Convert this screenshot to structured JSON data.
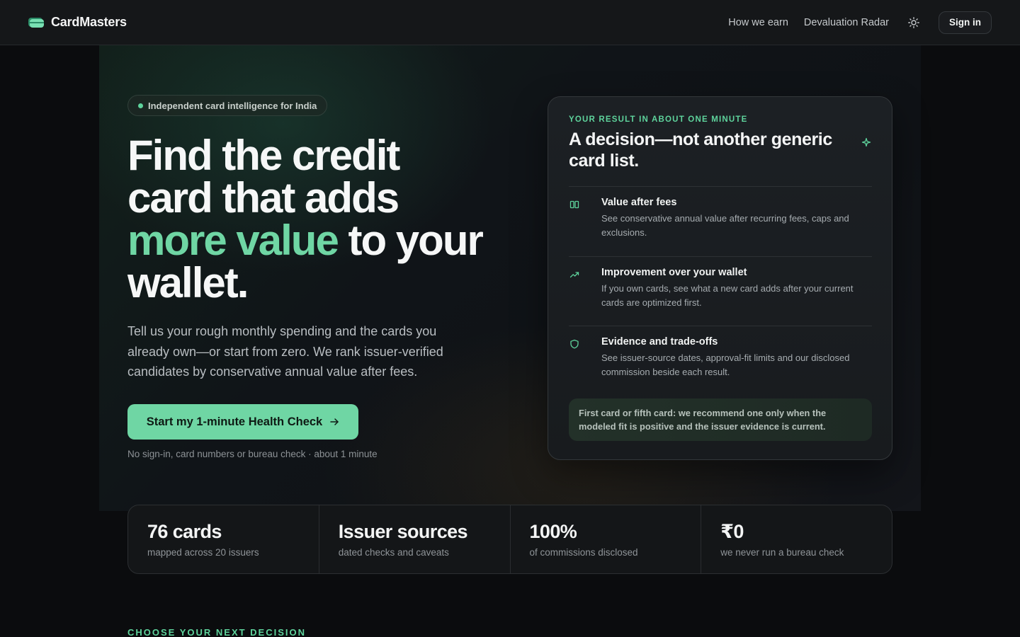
{
  "header": {
    "brand": "CardMasters",
    "nav": [
      "How we earn",
      "Devaluation Radar"
    ],
    "theme_icon": "sun-icon",
    "signin_label": "Sign in"
  },
  "hero": {
    "eyebrow": "Independent card intelligence for India",
    "title_line1": "Find the credit",
    "title_line2": "card that adds",
    "title_accent": "more value",
    "title_after_accent": " to your",
    "title_line4": "wallet.",
    "subtitle": "Tell us your rough monthly spending and the cards you already own—or start from zero. We rank issuer-verified candidates by conservative annual value after fees.",
    "cta_label": "Start my 1-minute Health Check",
    "cta_icon": "arrow-right-icon",
    "cta_note": "No sign-in, card numbers or bureau check · about 1 minute"
  },
  "result_card": {
    "eyebrow": "YOUR RESULT IN ABOUT ONE MINUTE",
    "title": "A decision—not another generic card list.",
    "sparkle_icon": "sparkle-icon",
    "items": [
      {
        "icon": "columns-icon",
        "title": "Value after fees",
        "desc": "See conservative annual value after recurring fees, caps and exclusions."
      },
      {
        "icon": "trending-up-icon",
        "title": "Improvement over your wallet",
        "desc": "If you own cards, see what a new card adds after your current cards are optimized first."
      },
      {
        "icon": "shield-icon",
        "title": "Evidence and trade-offs",
        "desc": "See issuer-source dates, approval-fit limits and our disclosed commission beside each result."
      }
    ],
    "note": "First card or fifth card: we recommend one only when the modeled fit is positive and the issuer evidence is current."
  },
  "stats": [
    {
      "value": "76 cards",
      "label": "mapped across 20 issuers"
    },
    {
      "value": "Issuer sources",
      "label": "dated checks and caveats"
    },
    {
      "value": "100%",
      "label": "of commissions disclosed"
    },
    {
      "value": "₹0",
      "label": "we never run a bureau check"
    }
  ],
  "next_section": {
    "heading": "CHOOSE YOUR NEXT DECISION"
  },
  "colors": {
    "accent": "#6fd6a4",
    "background": "#0b0c0e"
  }
}
